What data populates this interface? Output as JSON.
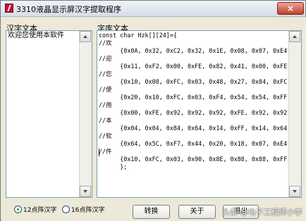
{
  "window": {
    "title": "3310液晶显示屏汉字提取程序",
    "close_glyph": "×"
  },
  "left_panel": {
    "label": "汉字文本",
    "text": "欢迎您使用本软件"
  },
  "right_panel": {
    "label": "字库文本",
    "lines": [
      "const char Hzk[][24]={",
      "//欢",
      "      {0x0A, 0x32, 0xC2, 0x32, 0x1E, 0x08, 0x07, 0xE4, 0x",
      "//迎",
      "      {0x11, 0xF2, 0x00, 0xFE, 0x82, 0x41, 0x00, 0xFE, 0x",
      "//您",
      "      {0x10, 0x08, 0xFC, 0x03, 0x48, 0x27, 0x84, 0xFC, 0x",
      "//使",
      "      {0x20, 0x10, 0xFC, 0x03, 0xF4, 0x54, 0x54, 0xFF, 0x",
      "//用",
      "      {0x00, 0xFE, 0x92, 0x92, 0x92, 0xFE, 0x92, 0x92, 0x",
      "//本",
      "      {0x04, 0x04, 0x84, 0x64, 0x14, 0xFF, 0x14, 0x64, 0x",
      "//软",
      "      {0x64, 0x5C, 0xF7, 0x44, 0x20, 0x18, 0x07, 0xE4, 0x",
      "//件",
      "      {0x10, 0xFC, 0x03, 0x90, 0x8E, 0x88, 0x88, 0xFF, 0x",
      "      };"
    ]
  },
  "options": {
    "radio_12": "12点阵汉字",
    "radio_16": "16点阵汉字",
    "selected": "12点阵汉字"
  },
  "buttons": {
    "convert": "转换",
    "about": "关于",
    "exit": "退出"
  },
  "watermark": "头条 @电子工程师小李"
}
